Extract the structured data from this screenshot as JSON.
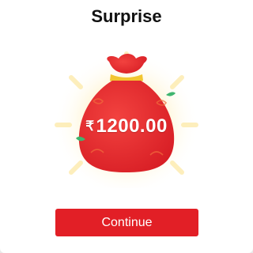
{
  "dialog": {
    "title": "Surprise"
  },
  "reward": {
    "currency_symbol": "₹",
    "amount": "1200.00"
  },
  "actions": {
    "continue_label": "Continue"
  },
  "colors": {
    "button": "#e21f26",
    "bag": "#e3262c",
    "bag_tie": "#f2c530",
    "glow": "#fff3c4",
    "corner_accent": "#26a69a"
  },
  "icons": {
    "bag": "red-money-bag-icon"
  }
}
